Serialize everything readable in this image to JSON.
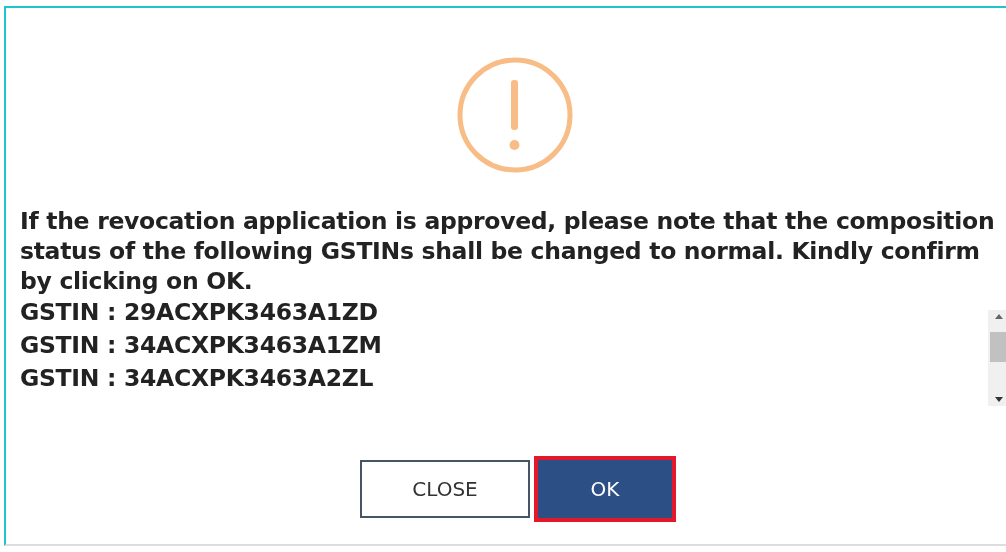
{
  "dialog": {
    "message": "If the revocation application is approved, please note that the composition status of the following GSTINs shall be changed to normal. Kindly confirm by clicking on OK.",
    "gstins": [
      "GSTIN : 29ACXPK3463A1ZD",
      "GSTIN : 34ACXPK3463A1ZM",
      "GSTIN : 34ACXPK3463A2ZL"
    ],
    "buttons": [
      {
        "label": "CLOSE",
        "kind": "secondary",
        "focused": false
      },
      {
        "label": "OK",
        "kind": "primary",
        "focused": true
      }
    ]
  }
}
